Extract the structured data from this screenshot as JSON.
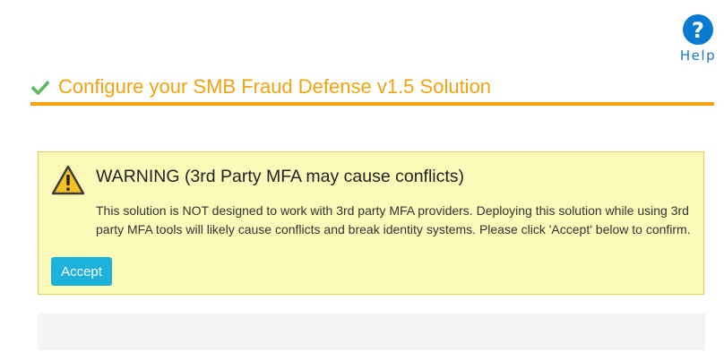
{
  "help": {
    "label": "Help",
    "icon": "question-mark-icon",
    "color": "#0a7bd1"
  },
  "header": {
    "title": "Configure your SMB Fraud Defense v1.5 Solution",
    "icon": "checkmark-icon",
    "accent_color": "#f2a30f",
    "check_color": "#5cb85c"
  },
  "warning": {
    "icon": "warning-triangle-icon",
    "title": "WARNING (3rd Party MFA may cause conflicts)",
    "message": "This solution is NOT designed to work with 3rd party MFA providers. Deploying this solution while using 3rd party MFA tools will likely cause conflicts and break identity systems. Please click 'Accept' below to confirm.",
    "accept_label": "Accept",
    "background_color": "#fcfab8",
    "button_color": "#1cb2dc"
  }
}
